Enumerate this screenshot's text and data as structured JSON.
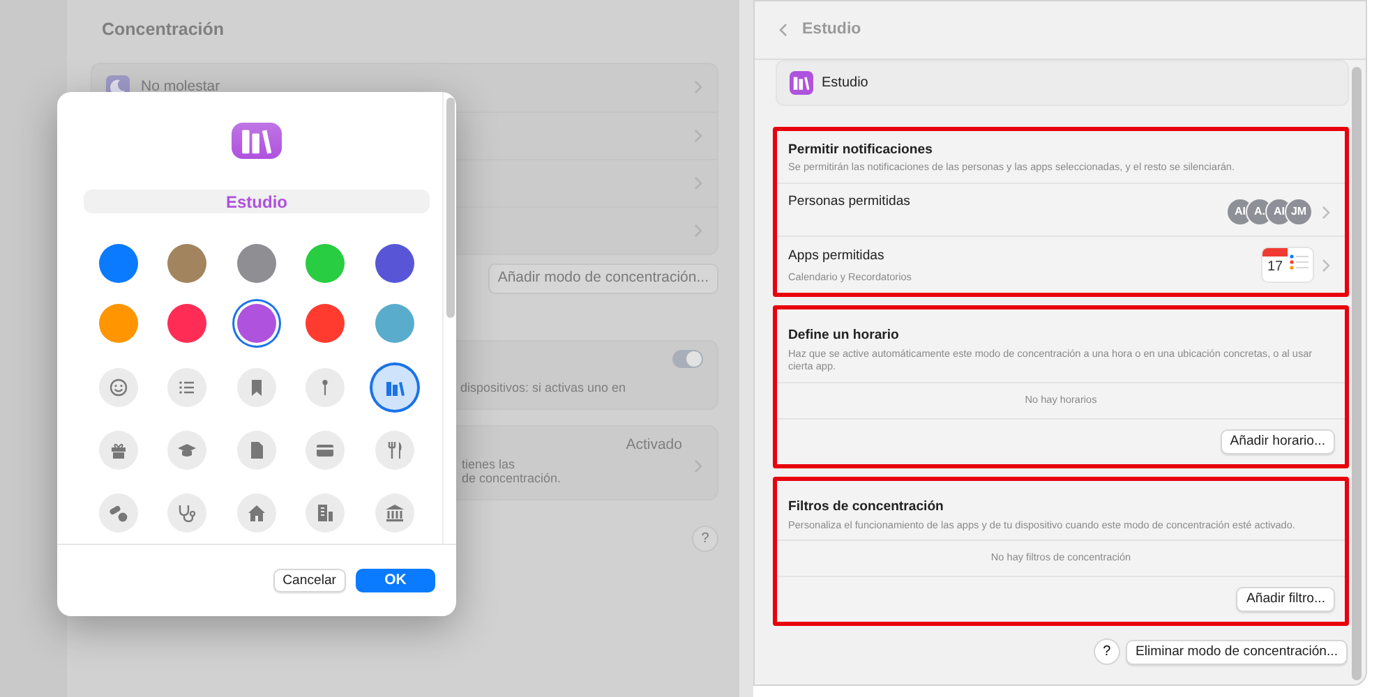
{
  "background_window": {
    "title": "Concentración",
    "modes": [
      {
        "label": "No molestar"
      }
    ],
    "add_mode_button": "Añadir modo de concentración...",
    "share_card": {
      "text": "dispositivos: si activas uno en",
      "on": true
    },
    "status_card": {
      "value": "Activado",
      "lines": [
        "tienes las",
        "de concentración."
      ]
    },
    "help": "?"
  },
  "dialog": {
    "name_value": "Estudio",
    "colors": [
      {
        "color": "#0a7aff",
        "selected": false
      },
      {
        "color": "#a2845e",
        "selected": false
      },
      {
        "color": "#8e8e93",
        "selected": false
      },
      {
        "color": "#28cd41",
        "selected": false
      },
      {
        "color": "#5856d6",
        "selected": false
      },
      {
        "color": "#ff9500",
        "selected": false
      },
      {
        "color": "#ff2d55",
        "selected": false
      },
      {
        "color": "#af52de",
        "selected": true
      },
      {
        "color": "#ff3b30",
        "selected": false
      },
      {
        "color": "#5aaccc",
        "selected": false
      }
    ],
    "symbols": [
      {
        "kind": "smiley",
        "selected": false
      },
      {
        "kind": "list",
        "selected": false
      },
      {
        "kind": "bookmark",
        "selected": false
      },
      {
        "kind": "pin",
        "selected": false
      },
      {
        "kind": "books",
        "selected": true
      },
      {
        "kind": "gift",
        "selected": false
      },
      {
        "kind": "cap",
        "selected": false
      },
      {
        "kind": "document",
        "selected": false
      },
      {
        "kind": "card",
        "selected": false
      },
      {
        "kind": "cutlery",
        "selected": false
      },
      {
        "kind": "pills",
        "selected": false
      },
      {
        "kind": "stethoscope",
        "selected": false
      },
      {
        "kind": "house",
        "selected": false
      },
      {
        "kind": "building",
        "selected": false
      },
      {
        "kind": "bank",
        "selected": false
      }
    ],
    "cancel_button": "Cancelar",
    "ok_button": "OK"
  },
  "detail": {
    "title": "Estudio",
    "mode_name": "Estudio",
    "sections": [
      {
        "kind": "rows",
        "highlighted": true,
        "title": "Permitir notificaciones",
        "description": "Se permitirán las notificaciones de las personas y las apps seleccionadas, y el resto se silenciarán.",
        "rows": [
          {
            "kind": "people",
            "label": "Personas permitidas",
            "avatars": [
              "AI",
              "A.",
              "AI",
              "JM"
            ]
          },
          {
            "kind": "apps",
            "label": "Apps permitidas",
            "detail": "Calendario y Recordatorios",
            "calendar_day": "17"
          }
        ]
      },
      {
        "kind": "empty",
        "highlighted": true,
        "title": "Define un horario",
        "description": "Haz que se active automáticamente este modo de concentración a una hora o en una ubicación concretas, o al usar cierta app.",
        "empty_text": "No hay horarios",
        "button": "Añadir horario..."
      },
      {
        "kind": "empty",
        "highlighted": true,
        "title": "Filtros de concentración",
        "description": "Personaliza el funcionamiento de las apps y de tu dispositivo cuando este modo de concentración esté activado.",
        "empty_text": "No hay filtros de concentración",
        "button": "Añadir filtro..."
      }
    ],
    "help": "?",
    "delete_button": "Eliminar modo de concentración..."
  }
}
